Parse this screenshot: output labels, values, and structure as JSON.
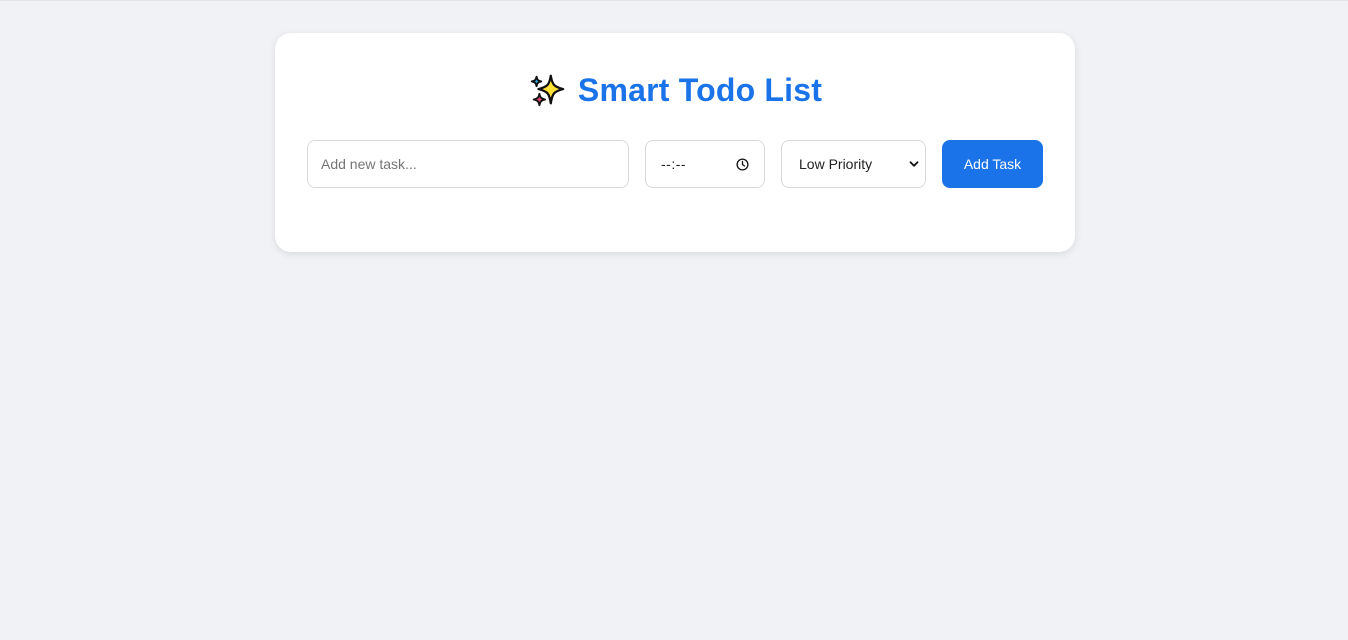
{
  "app": {
    "title": "Smart Todo List",
    "title_icon": "sparkles-icon",
    "accent_color": "#1a73e8",
    "background_color": "#f0f2f5"
  },
  "form": {
    "task_input": {
      "value": "",
      "placeholder": "Add new task..."
    },
    "time_input": {
      "display": "--:--",
      "icon": "clock-icon"
    },
    "priority_select": {
      "selected": "Low Priority",
      "icon": "chevron-down-icon"
    },
    "add_button_label": "Add Task"
  }
}
